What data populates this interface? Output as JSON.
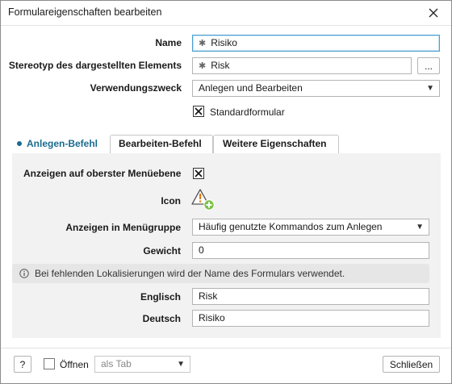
{
  "window": {
    "title": "Formulareigenschaften bearbeiten"
  },
  "form": {
    "name_label": "Name",
    "name_value": "Risiko",
    "stereotype_label": "Stereotyp des dargestellten Elements",
    "stereotype_value": "Risk",
    "stereotype_browse": "...",
    "purpose_label": "Verwendungszweck",
    "purpose_value": "Anlegen und Bearbeiten",
    "standard_form_label": "Standardformular",
    "standard_form_checked": true
  },
  "tabs": [
    {
      "label": "Anlegen-Befehl",
      "active": true
    },
    {
      "label": "Bearbeiten-Befehl",
      "active": false
    },
    {
      "label": "Weitere Eigenschaften",
      "active": false
    }
  ],
  "panel": {
    "show_top_menu_label": "Anzeigen auf oberster Menüebene",
    "show_top_menu_checked": true,
    "icon_label": "Icon",
    "menu_group_label": "Anzeigen in Menügruppe",
    "menu_group_value": "Häufig genutzte Kommandos zum Anlegen",
    "weight_label": "Gewicht",
    "weight_value": "0",
    "info_text": "Bei fehlenden Lokalisierungen wird der Name des Formulars verwendet.",
    "english_label": "Englisch",
    "english_value": "Risk",
    "german_label": "Deutsch",
    "german_value": "Risiko"
  },
  "footer": {
    "help_label": "?",
    "open_label": "Öffnen",
    "open_checked": false,
    "open_mode_value": "als Tab",
    "close_label": "Schließen"
  },
  "colors": {
    "accent": "#1a6b8f",
    "focus_border": "#4a9fd0",
    "panel_bg": "#f2f2f2"
  }
}
